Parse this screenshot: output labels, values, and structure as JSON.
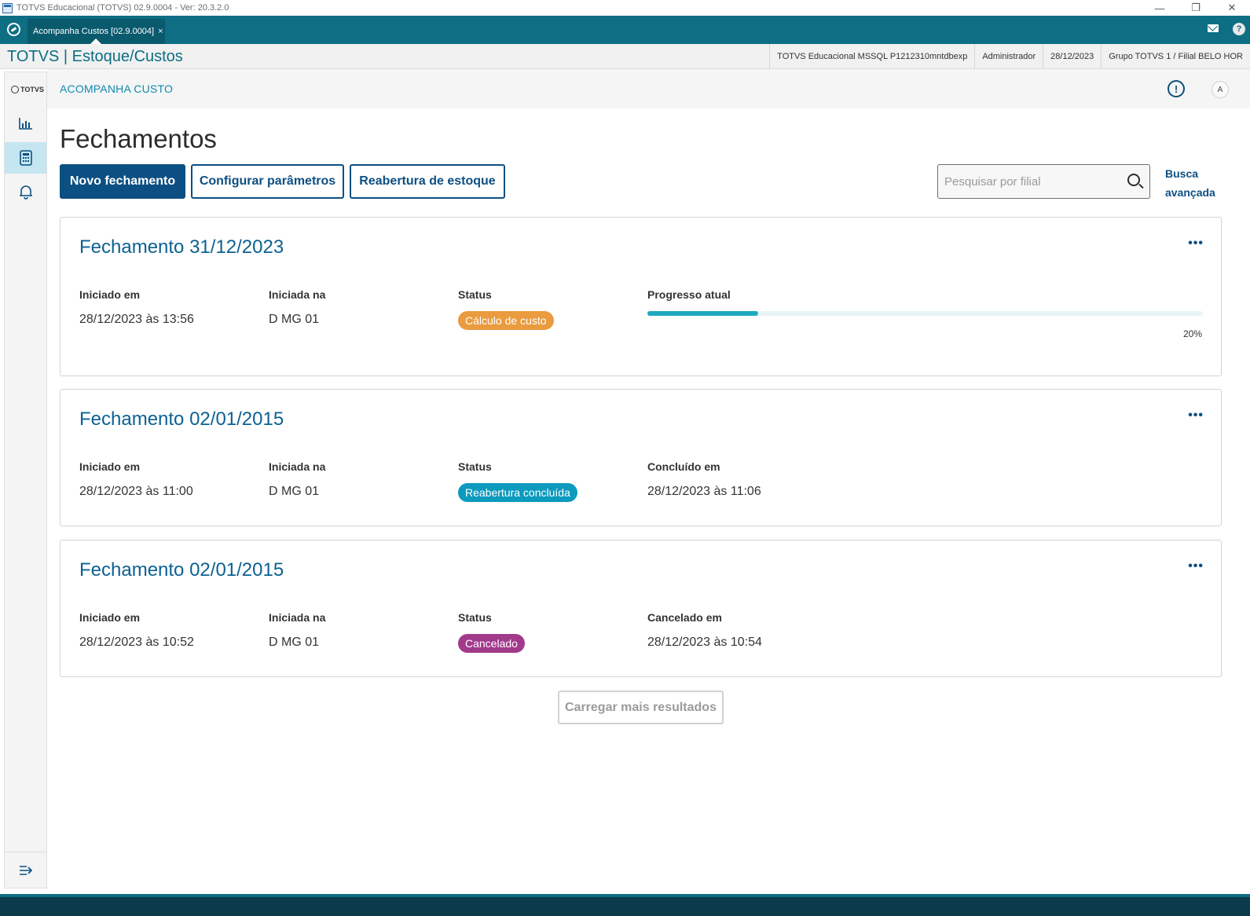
{
  "window": {
    "title": "TOTVS Educacional (TOTVS) 02.9.0004 - Ver: 20.3.2.0",
    "minimize": "—",
    "restore": "❐",
    "close": "✕"
  },
  "tabbar": {
    "active_tab": "Acompanha Custos [02.9.0004]",
    "close_tab": "×",
    "help": "?"
  },
  "header": {
    "brand": "TOTVS | Estoque/Custos",
    "environment": "TOTVS Educacional MSSQL P1212310mntdbexp",
    "user": "Administrador",
    "date": "28/12/2023",
    "branch": "Grupo TOTVS 1 / Filial BELO HOR"
  },
  "sidebar": {
    "logo": "TOTVS",
    "items": [
      {
        "icon": "chart-icon",
        "active": false
      },
      {
        "icon": "calculator-icon",
        "active": true
      },
      {
        "icon": "bell-icon",
        "active": false
      }
    ],
    "collapse_icon": "menu-collapse-icon"
  },
  "subheader": {
    "breadcrumb": "ACOMPANHA CUSTO",
    "warn": "!",
    "user_initial": "A"
  },
  "page": {
    "title": "Fechamentos",
    "buttons": {
      "new": "Novo fechamento",
      "config": "Configurar parâmetros",
      "reopen": "Reabertura de estoque"
    },
    "search": {
      "placeholder": "Pesquisar por filial",
      "value": ""
    },
    "advanced_search": "Busca avançada",
    "load_more": "Carregar mais resultados"
  },
  "cards": [
    {
      "title": "Fechamento 31/12/2023",
      "more": "•••",
      "started_label": "Iniciado em",
      "started_value": "28/12/2023 às 13:56",
      "branch_label": "Iniciada na",
      "branch_value": "D MG 01",
      "status_label": "Status",
      "status_value": "Cálculo de custo",
      "status_color": "#ea9b3e",
      "progress_label": "Progresso atual",
      "progress_value": 20,
      "progress_text": "20%"
    },
    {
      "title": "Fechamento 02/01/2015",
      "more": "•••",
      "started_label": "Iniciado em",
      "started_value": "28/12/2023 às 11:00",
      "branch_label": "Iniciada na",
      "branch_value": "D MG 01",
      "status_label": "Status",
      "status_value": "Reabertura concluída",
      "status_color": "#0c9abe",
      "end_label": "Concluído em",
      "end_value": "28/12/2023 às 11:06"
    },
    {
      "title": "Fechamento 02/01/2015",
      "more": "•••",
      "started_label": "Iniciado em",
      "started_value": "28/12/2023 às 10:52",
      "branch_label": "Iniciada na",
      "branch_value": "D MG 01",
      "status_label": "Status",
      "status_value": "Cancelado",
      "status_color": "#a23a8c",
      "end_label": "Cancelado em",
      "end_value": "28/12/2023 às 10:54"
    }
  ]
}
